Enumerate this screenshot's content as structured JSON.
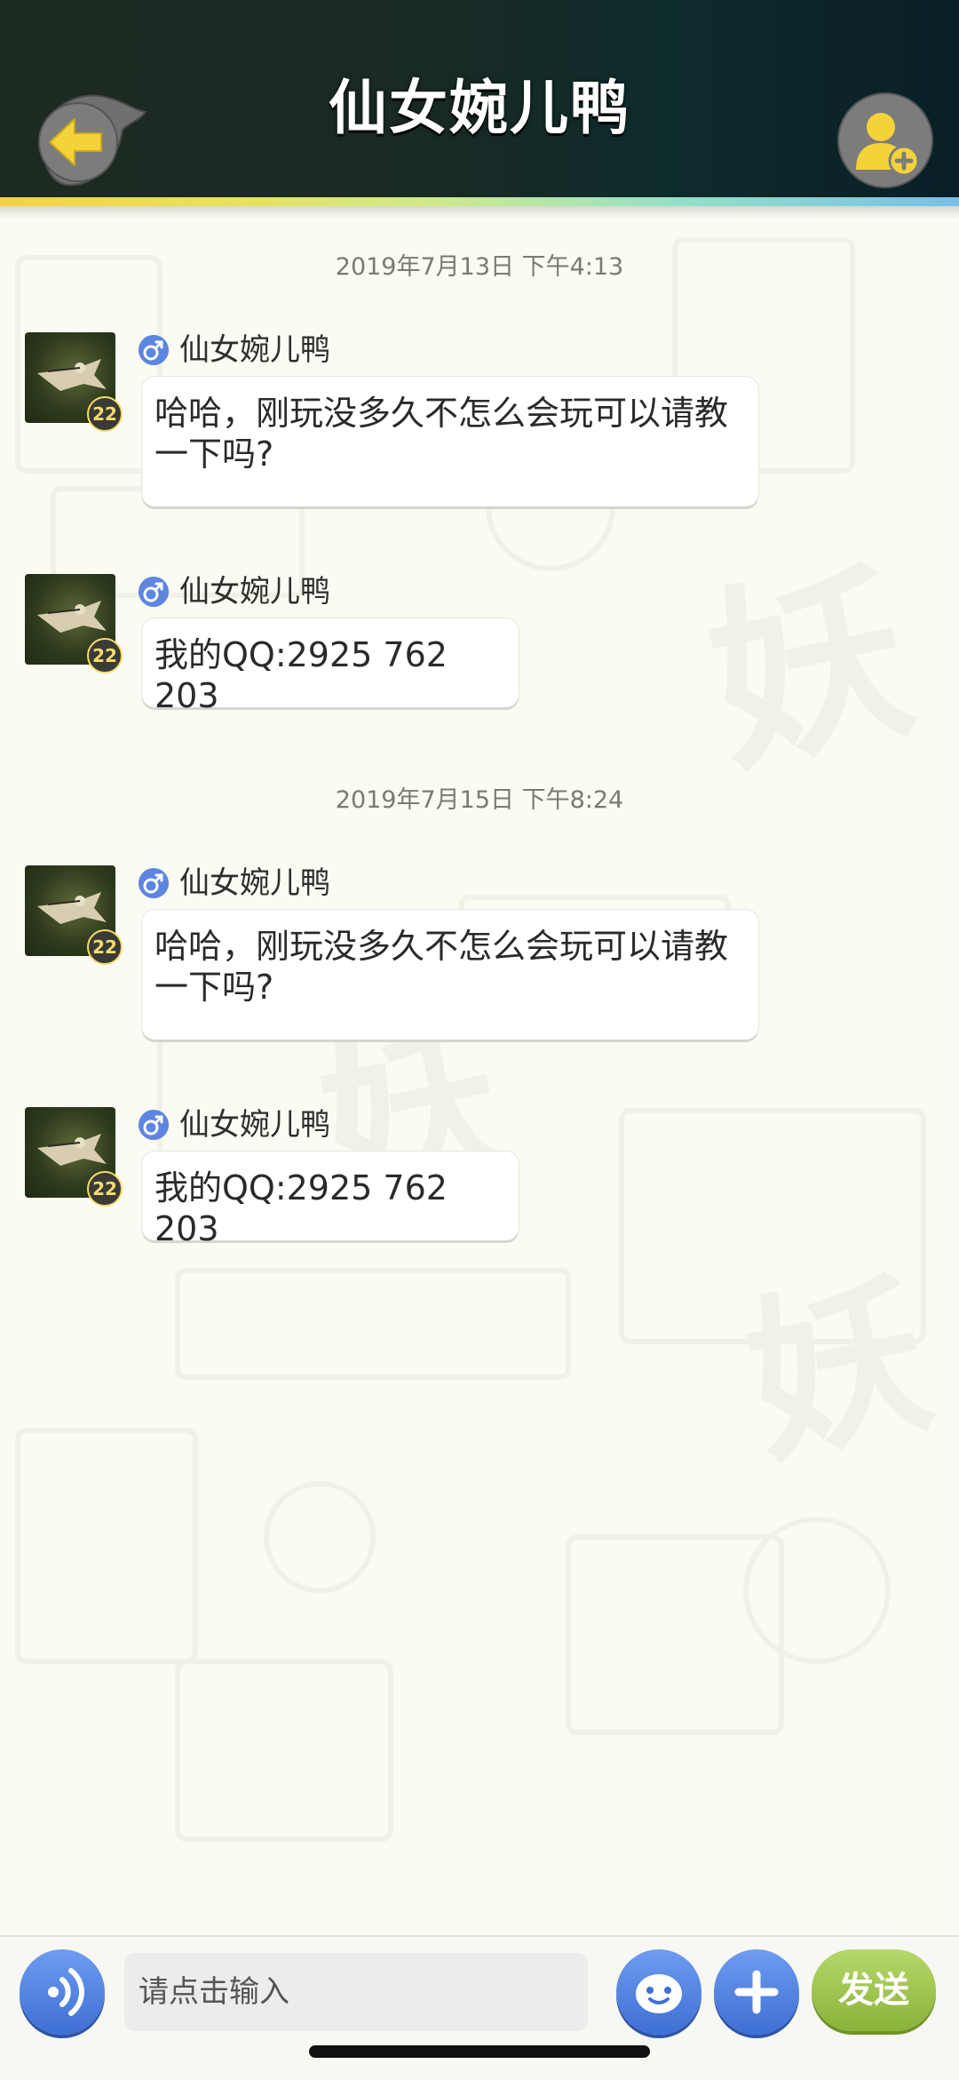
{
  "header": {
    "title": "仙女婉儿鸭",
    "back_icon": "back-arrow-icon",
    "add_friend_icon": "add-friend-icon"
  },
  "messages": [
    {
      "timestamp": "2019年7月13日 下午4:13"
    },
    {
      "sender": "仙女婉儿鸭",
      "level": "22",
      "gender": "male",
      "text": "哈哈，刚玩没多久不怎么会玩可以请教一下吗?"
    },
    {
      "sender": "仙女婉儿鸭",
      "level": "22",
      "gender": "male",
      "text": "我的QQ:2925 762 203"
    },
    {
      "timestamp": "2019年7月15日 下午8:24"
    },
    {
      "sender": "仙女婉儿鸭",
      "level": "22",
      "gender": "male",
      "text": "哈哈，刚玩没多久不怎么会玩可以请教一下吗?"
    },
    {
      "sender": "仙女婉儿鸭",
      "level": "22",
      "gender": "male",
      "text": "我的QQ:2925 762 203"
    }
  ],
  "input": {
    "placeholder": "请点击输入",
    "send_label": "发送"
  },
  "colors": {
    "header_bg": "#1b2a24",
    "accent_blue": "#4a7ee0",
    "send_green": "#9cc44e",
    "background": "#fbfbf4"
  }
}
